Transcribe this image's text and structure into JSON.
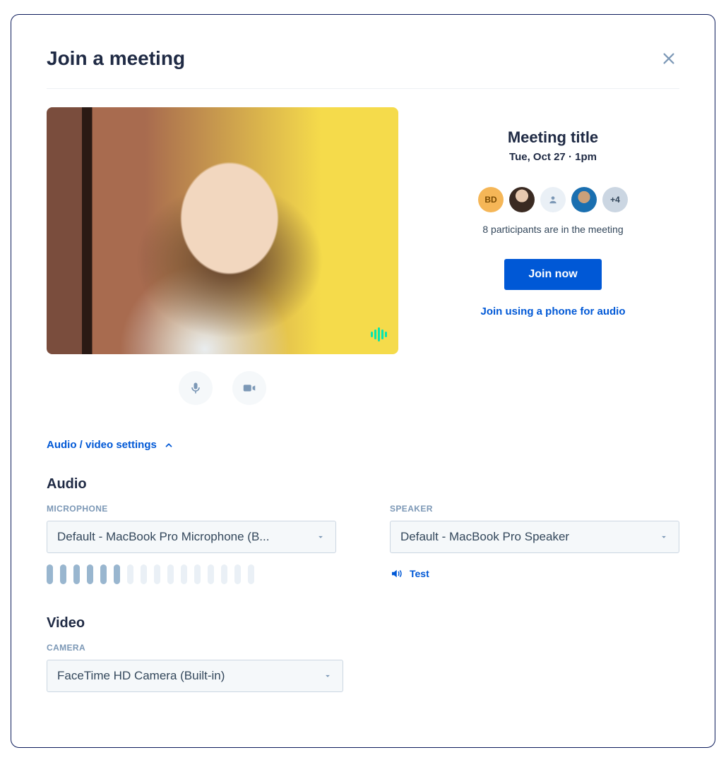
{
  "modal": {
    "title": "Join a meeting"
  },
  "meeting": {
    "title": "Meeting title",
    "datetime": "Tue, Oct 27 · 1pm",
    "avatars": {
      "bd_initials": "BD",
      "more_label": "+4"
    },
    "participants_text": "8 participants are in the meeting",
    "join_label": "Join now",
    "phone_link": "Join using a phone for audio"
  },
  "settings": {
    "toggle_label": "Audio / video settings",
    "audio_heading": "Audio",
    "microphone_label": "MICROPHONE",
    "microphone_value": "Default - MacBook Pro Microphone (B...",
    "speaker_label": "SPEAKER",
    "speaker_value": "Default - MacBook Pro Speaker",
    "test_label": "Test",
    "video_heading": "Video",
    "camera_label": "CAMERA",
    "camera_value": "FaceTime HD Camera (Built-in)",
    "mic_level_active_bars": 6,
    "mic_level_total_bars": 16
  }
}
